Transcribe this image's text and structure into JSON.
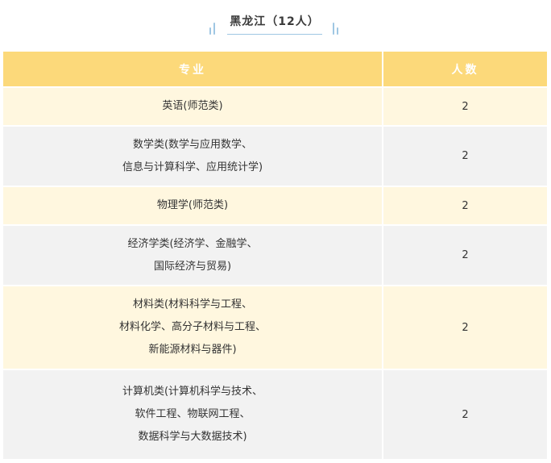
{
  "title": "黑龙江（12人）",
  "header": {
    "major_label": "专业",
    "count_label": "人数"
  },
  "rows": [
    {
      "lines": [
        "英语(师范类)"
      ],
      "count": "2"
    },
    {
      "lines": [
        "数学类(数学与应用数学、",
        "信息与计算科学、应用统计学)"
      ],
      "count": "2"
    },
    {
      "lines": [
        "物理学(师范类)"
      ],
      "count": "2"
    },
    {
      "lines": [
        "经济学类(经济学、金融学、",
        "国际经济与贸易)"
      ],
      "count": "2"
    },
    {
      "lines": [
        "材料类(材料科学与工程、",
        "材料化学、高分子材料与工程、",
        "新能源材料与器件)"
      ],
      "count": "2"
    },
    {
      "lines": [
        "计算机类(计算机科学与技术、",
        "软件工程、物联网工程、",
        "数据科学与大数据技术)"
      ],
      "count": "2"
    }
  ]
}
